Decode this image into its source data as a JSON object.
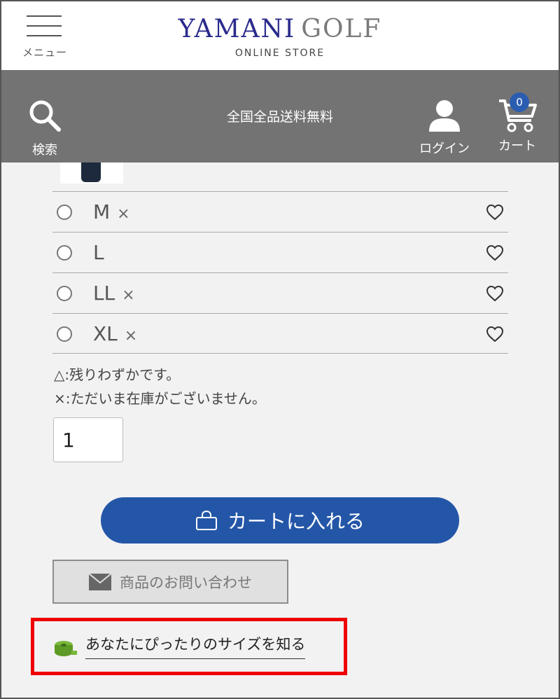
{
  "header": {
    "menu_label": "メニュー",
    "logo_primary": "YAMANI",
    "logo_secondary": "GOLF",
    "logo_tagline": "ONLINE STORE"
  },
  "nav": {
    "search_label": "検索",
    "promo_text": "全国全品送料無料",
    "login_label": "ログイン",
    "cart_label": "カート",
    "cart_count": "0"
  },
  "sizes": [
    {
      "label": "M",
      "mark": "×"
    },
    {
      "label": "L",
      "mark": ""
    },
    {
      "label": "LL",
      "mark": "×"
    },
    {
      "label": "XL",
      "mark": "×"
    }
  ],
  "legend": {
    "few_left": "△:残りわずかです。",
    "out_of_stock": "×:ただいま在庫がございません。"
  },
  "quantity": {
    "value": "1"
  },
  "actions": {
    "add_to_cart": "カートに入れる",
    "inquiry": "商品のお問い合わせ",
    "size_guide": "あなたにぴったりのサイズを知る"
  },
  "colors": {
    "navbar": "#737373",
    "primary_button": "#2456a8",
    "highlight": "#ee0000",
    "brand": "#2a2a8c"
  }
}
